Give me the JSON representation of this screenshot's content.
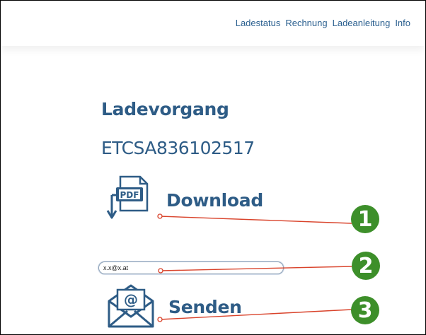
{
  "nav": {
    "items": [
      {
        "label": "Ladestatus"
      },
      {
        "label": "Rechnung"
      },
      {
        "label": "Ladeanleitung"
      },
      {
        "label": "Info"
      }
    ]
  },
  "main": {
    "title": "Ladevorgang",
    "session_id": "ETCSA836102517",
    "download": {
      "icon_text": "PDF",
      "label": "Download"
    },
    "email_input": {
      "value": "x.x@x.at"
    },
    "send": {
      "label": "Senden"
    }
  },
  "callouts": [
    {
      "number": "1"
    },
    {
      "number": "2"
    },
    {
      "number": "3"
    }
  ],
  "colors": {
    "primary": "#2e5c86",
    "badge": "#3d8f2a",
    "callout_line": "#d9432b"
  }
}
